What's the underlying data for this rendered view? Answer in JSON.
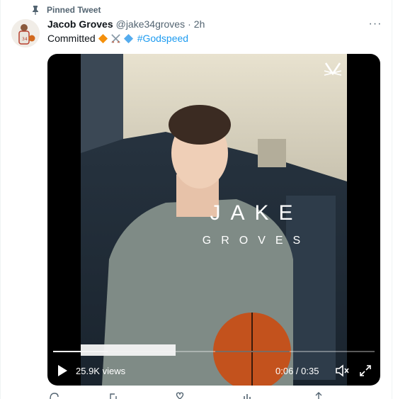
{
  "pinned": {
    "label": "Pinned Tweet",
    "icon": "pin-icon"
  },
  "author": {
    "name": "Jacob Groves",
    "handle": "@jake34groves",
    "separator": "·",
    "time": "2h"
  },
  "more": {
    "icon": "more-icon",
    "label": "···"
  },
  "tweet": {
    "text": "Committed",
    "emojis": [
      "orange-diamond-icon",
      "crossed-swords-icon",
      "blue-diamond-icon"
    ],
    "hashtag": "#Godspeed"
  },
  "video": {
    "overlay_title_1": "JAKE",
    "overlay_title_2": "GROVES",
    "views": "25.9K views",
    "time": "0:06 / 0:35",
    "progress": 0.17,
    "buffered_label": "",
    "icons": [
      "play-icon",
      "volume-icon",
      "fullscreen-icon",
      "team-logo-icon"
    ]
  },
  "actions": [
    "reply-icon",
    "retweet-icon",
    "like-icon",
    "views-icon",
    "share-icon"
  ],
  "colors": {
    "link": "#1d9bf0",
    "muted": "#536471",
    "text": "#0f1419"
  }
}
